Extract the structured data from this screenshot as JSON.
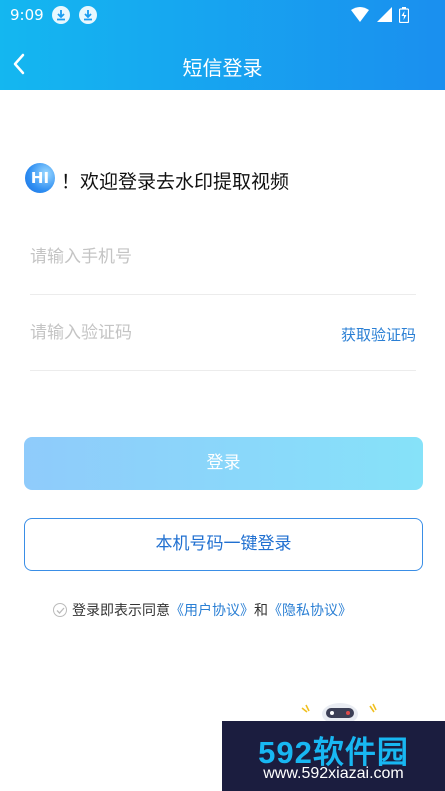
{
  "status_bar": {
    "time": "9:09"
  },
  "header": {
    "title": "短信登录"
  },
  "welcome": {
    "badge": "HI",
    "text": "！欢迎登录去水印提取视频"
  },
  "phone": {
    "placeholder": "请输入手机号"
  },
  "code": {
    "placeholder": "请输入验证码",
    "get_code_label": "获取验证码"
  },
  "login_button": "登录",
  "onekey_button": "本机号码一键登录",
  "agreement": {
    "prefix": "登录即表示同意",
    "user_agreement": "《用户协议》",
    "conjunction": "和",
    "privacy_agreement": "《隐私协议》"
  },
  "watermark": {
    "main": "592软件园",
    "url": "www.592xiazai.com"
  },
  "icons": [
    "download-icon",
    "download-icon",
    "wifi-icon",
    "signal-icon",
    "battery-icon",
    "back-arrow-icon",
    "checkbox-icon",
    "mascot-icon"
  ],
  "colors": {
    "header_start": "#14b7f0",
    "header_end": "#1a8fef",
    "link": "#2a7fd4",
    "login_start": "#8fcbfb",
    "login_end": "#86e2f9"
  }
}
